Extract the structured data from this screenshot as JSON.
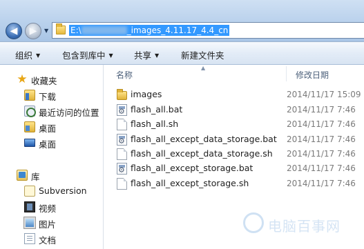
{
  "address_bar": {
    "path_start": "E:\\",
    "path_end": "_images_4.11.17_4.4_cn"
  },
  "toolbar": {
    "organize": "组织",
    "include_in_library": "包含到库中",
    "share": "共享",
    "new_folder": "新建文件夹"
  },
  "nav_pane": {
    "favorites": "收藏夹",
    "downloads": "下载",
    "recent": "最近访问的位置",
    "desktop_folder": "桌面",
    "desktop": "桌面",
    "libraries": "库",
    "subversion": "Subversion",
    "videos": "视频",
    "pictures": "图片",
    "documents": "文档"
  },
  "columns": {
    "name": "名称",
    "modified": "修改日期"
  },
  "files": [
    {
      "name": "images",
      "date": "2014/11/17 15:09",
      "type": "folder"
    },
    {
      "name": "flash_all.bat",
      "date": "2014/11/17 7:46",
      "type": "bat"
    },
    {
      "name": "flash_all.sh",
      "date": "2014/11/17 7:46",
      "type": "sh"
    },
    {
      "name": "flash_all_except_data_storage.bat",
      "date": "2014/11/17 7:46",
      "type": "bat"
    },
    {
      "name": "flash_all_except_data_storage.sh",
      "date": "2014/11/17 7:46",
      "type": "sh"
    },
    {
      "name": "flash_all_except_storage.bat",
      "date": "2014/11/17 7:46",
      "type": "bat"
    },
    {
      "name": "flash_all_except_storage.sh",
      "date": "2014/11/17 7:46",
      "type": "sh"
    }
  ],
  "watermark": "电脑百事网"
}
